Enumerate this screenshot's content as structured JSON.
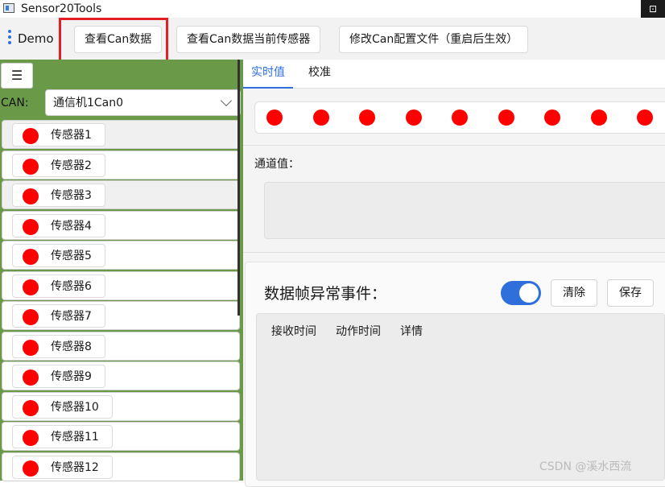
{
  "window": {
    "title": "Sensor20Tools",
    "close_glyph": "⊡"
  },
  "commandbar": {
    "app_label": "Demo",
    "buttons": [
      "查看Can数据",
      "查看Can数据当前传感器",
      "修改Can配置文件（重启后生效）"
    ]
  },
  "left": {
    "menu_glyph": "☰",
    "can_label": "CAN:",
    "can_select_value": "通信机1Can0",
    "sensors": [
      "传感器1",
      "传感器2",
      "传感器3",
      "传感器4",
      "传感器5",
      "传感器6",
      "传感器7",
      "传感器8",
      "传感器9",
      "传感器10",
      "传感器11",
      "传感器12"
    ],
    "status_color": "#ff0000"
  },
  "tabs": {
    "items": [
      "实时值",
      "校准"
    ],
    "active_index": 0
  },
  "channels": {
    "dot_count": 9,
    "dot_color": "#ff0000",
    "label": "通道值："
  },
  "events": {
    "title": "数据帧异常事件：",
    "toggle_on": true,
    "clear_label": "清除",
    "save_label": "保存",
    "columns": [
      "接收时间",
      "动作时间",
      "详情"
    ]
  },
  "watermark": "CSDN @溪水西流",
  "colors": {
    "accent": "#2f6fdc",
    "sidebar_green": "#6a9a47",
    "highlight_red": "#e31e24"
  }
}
